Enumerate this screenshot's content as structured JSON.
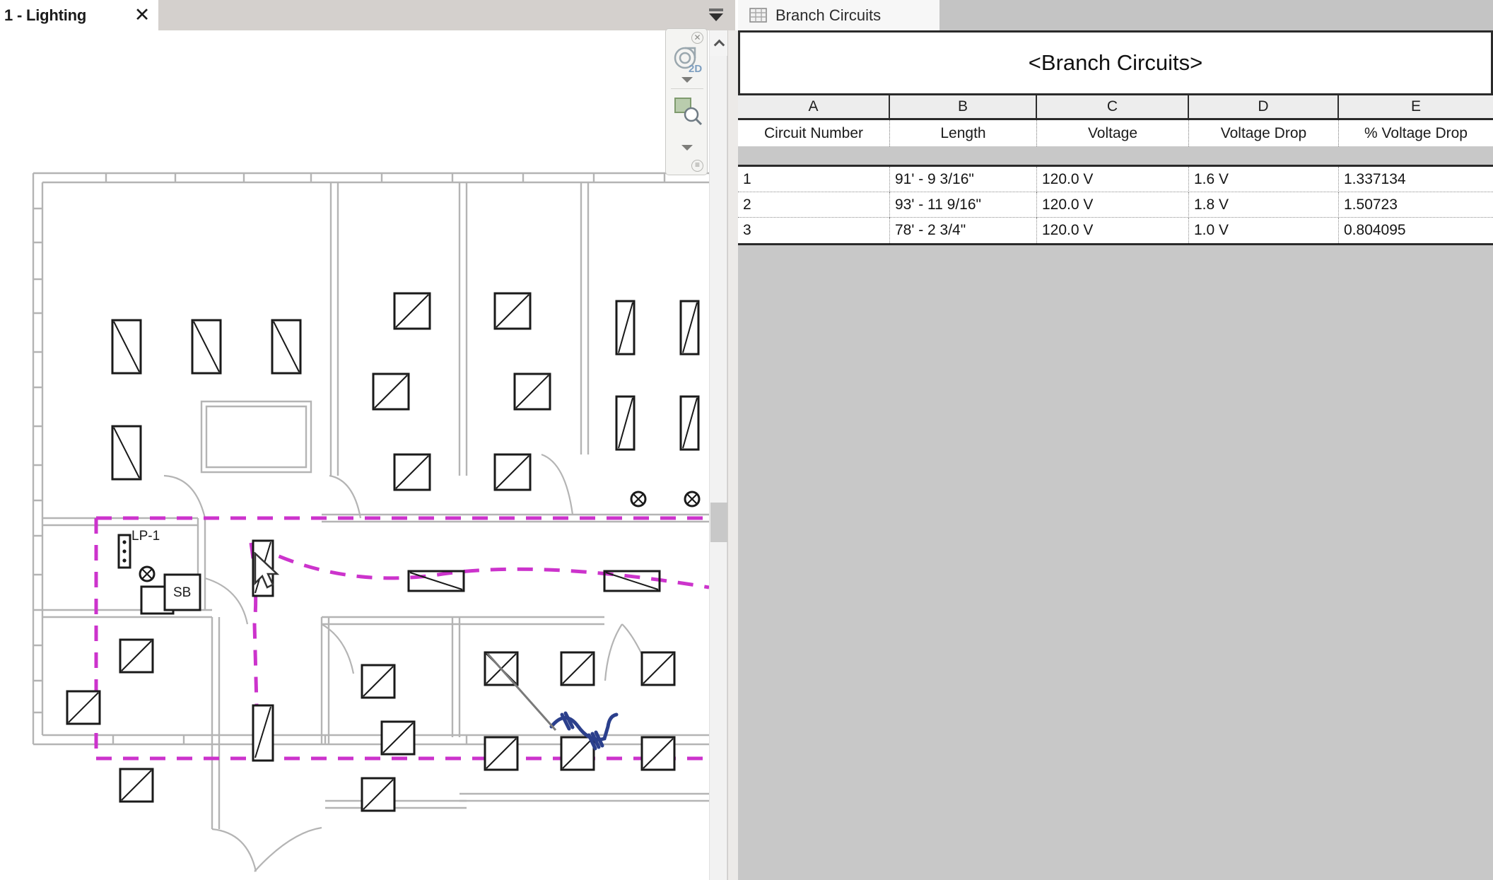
{
  "view_tab": {
    "label": "1 - Lighting",
    "close_label": "✕",
    "overflow_icon": "tab-overflow-icon"
  },
  "navigation_bar": {
    "close_icon": "close-icon",
    "steering_wheel_icon": "steering-wheel-2d-icon",
    "steering_wheel_label": "2D",
    "zoom_tool_icon": "zoom-region-icon",
    "caret_icon": "chevron-down-icon",
    "options_icon": "options-icon"
  },
  "scrollbar": {
    "up_icon": "chevron-up-icon",
    "thumb_name": "vertical-scroll-thumb"
  },
  "schedule_tab": {
    "label": "Branch Circuits",
    "icon": "table-icon"
  },
  "schedule": {
    "title": "<Branch Circuits>",
    "column_letters": [
      "A",
      "B",
      "C",
      "D",
      "E"
    ],
    "field_headers": [
      "Circuit Number",
      "Length",
      "Voltage",
      "Voltage Drop",
      "% Voltage Drop"
    ],
    "rows": [
      {
        "circuit_number": "1",
        "length": "91' - 9 3/16\"",
        "voltage": "120.0 V",
        "voltage_drop": "1.6 V",
        "percent_voltage_drop": "1.337134"
      },
      {
        "circuit_number": "2",
        "length": "93' - 11 9/16\"",
        "voltage": "120.0 V",
        "voltage_drop": "1.8 V",
        "percent_voltage_drop": "1.50723"
      },
      {
        "circuit_number": "3",
        "length": "78' - 2 3/4\"",
        "voltage": "120.0 V",
        "voltage_drop": "1.0 V",
        "percent_voltage_drop": "0.804095"
      }
    ]
  },
  "floor_plan": {
    "panel_tag": "LP-1",
    "equipment_tag": "SB",
    "circuit_color": "#cc33cc",
    "wire_color": "#2b3f8c",
    "wall_color": "#b4b4b4",
    "fixture_color": "#1a1a1a"
  }
}
